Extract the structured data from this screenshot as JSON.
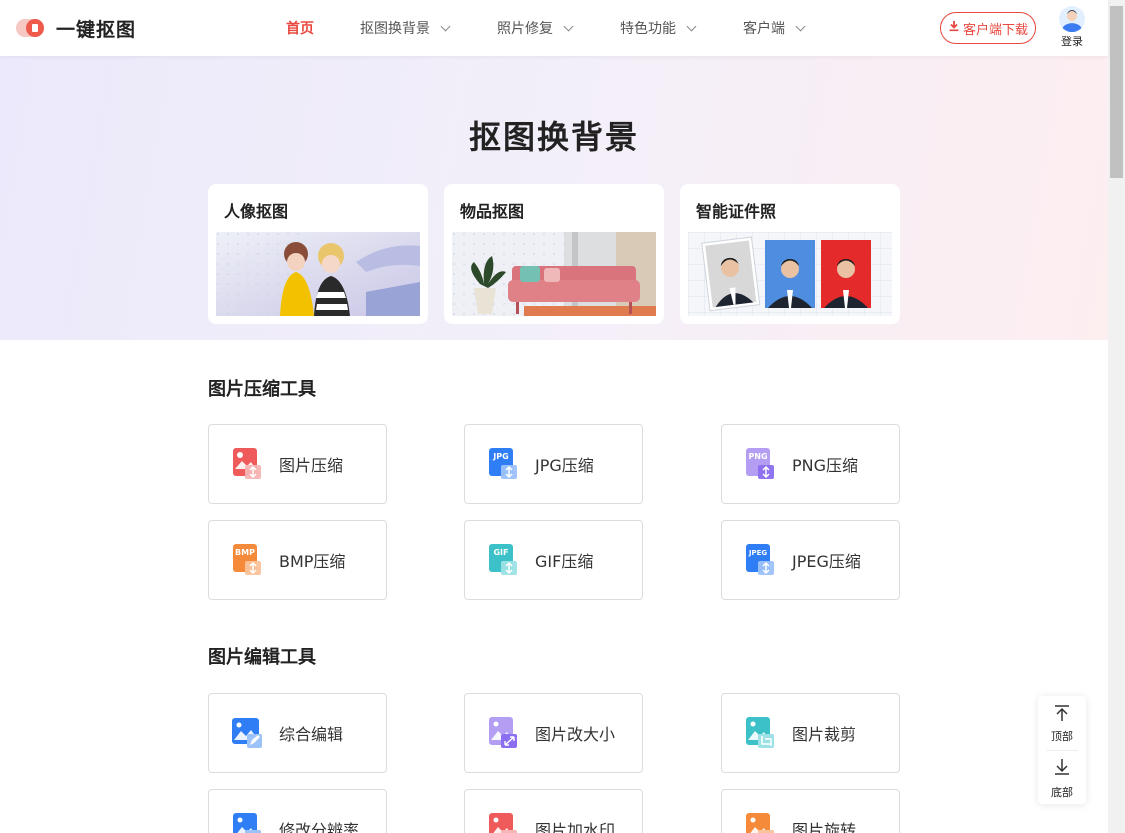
{
  "header": {
    "logo_text": "一键抠图",
    "nav": [
      {
        "label": "首页",
        "active": true,
        "dropdown": false
      },
      {
        "label": "抠图换背景",
        "active": false,
        "dropdown": true
      },
      {
        "label": "照片修复",
        "active": false,
        "dropdown": true
      },
      {
        "label": "特色功能",
        "active": false,
        "dropdown": true
      },
      {
        "label": "客户端",
        "active": false,
        "dropdown": true
      }
    ],
    "download_label": "客户端下载",
    "login_label": "登录"
  },
  "hero": {
    "title": "抠图换背景",
    "cards": [
      {
        "title": "人像抠图",
        "image": "portrait-cutout-image"
      },
      {
        "title": "物品抠图",
        "image": "object-cutout-image"
      },
      {
        "title": "智能证件照",
        "image": "id-photo-image"
      }
    ]
  },
  "compress": {
    "title": "图片压缩工具",
    "tools": [
      {
        "label": "图片压缩",
        "icon": "image-compress-icon",
        "color": "#ef5b5b",
        "tag": ""
      },
      {
        "label": "JPG压缩",
        "icon": "jpg-compress-icon",
        "color": "#2f7ef5",
        "tag": "JPG"
      },
      {
        "label": "PNG压缩",
        "icon": "png-compress-icon",
        "color": "#9b7cf0",
        "tag": "PNG"
      },
      {
        "label": "BMP压缩",
        "icon": "bmp-compress-icon",
        "color": "#f58a3a",
        "tag": "BMP"
      },
      {
        "label": "GIF压缩",
        "icon": "gif-compress-icon",
        "color": "#3cc1c9",
        "tag": "GIF"
      },
      {
        "label": "JPEG压缩",
        "icon": "jpeg-compress-icon",
        "color": "#2f7ef5",
        "tag": "JPEG"
      }
    ]
  },
  "edit": {
    "title": "图片编辑工具",
    "tools": [
      {
        "label": "综合编辑",
        "icon": "comprehensive-edit-icon",
        "color": "#2f7ef5"
      },
      {
        "label": "图片改大小",
        "icon": "resize-image-icon",
        "color": "#9b7cf0"
      },
      {
        "label": "图片裁剪",
        "icon": "crop-image-icon",
        "color": "#3cc1c9"
      },
      {
        "label": "修改分辨率",
        "icon": "change-resolution-icon",
        "color": "#2f7ef5"
      },
      {
        "label": "图片加水印",
        "icon": "add-watermark-icon",
        "color": "#ef5b5b"
      },
      {
        "label": "图片旋转",
        "icon": "rotate-image-icon",
        "color": "#f58a3a"
      }
    ]
  },
  "float": {
    "top_label": "顶部",
    "bottom_label": "底部"
  },
  "colors": {
    "accent": "#e8483f"
  }
}
